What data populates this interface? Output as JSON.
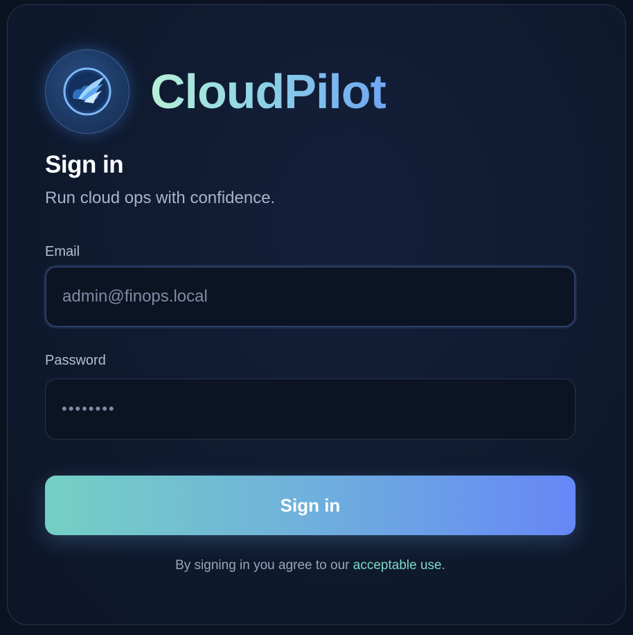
{
  "brand": {
    "name": "CloudPilot",
    "logo_icon": "cloud-wing-icon",
    "gradient_start": "#b7f0d8",
    "gradient_end": "#6ea6f2"
  },
  "form": {
    "title": "Sign in",
    "subtitle": "Run cloud ops with confidence.",
    "email": {
      "label": "Email",
      "placeholder": "admin@finops.local",
      "value": ""
    },
    "password": {
      "label": "Password",
      "placeholder": "••••••••",
      "value": ""
    },
    "submit_label": "Sign in",
    "submit_gradient": [
      "#74d0c4",
      "#6687f7"
    ]
  },
  "legal": {
    "prefix": "By signing in you agree to our ",
    "link_text": "acceptable use",
    "suffix": ".",
    "link_color": "#7ed9c6"
  }
}
